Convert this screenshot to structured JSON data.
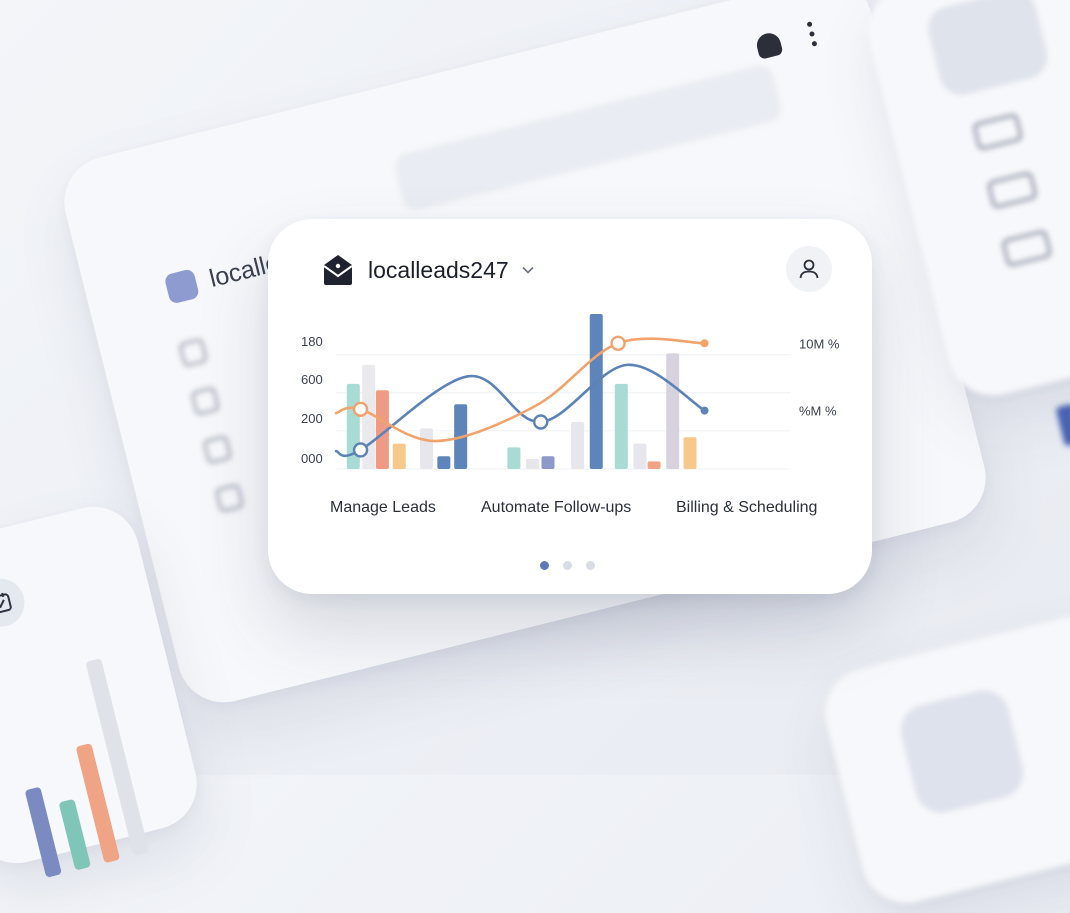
{
  "brand": {
    "name": "localleads247",
    "background_name": "localleads247"
  },
  "chart_data": {
    "type": "bar",
    "y_ticks": [
      "180",
      "600",
      "200",
      "000"
    ],
    "right_labels": [
      "10M %",
      "%M %"
    ],
    "categories": [
      "Manage Leads",
      "Automate Follow-ups",
      "Billing & Scheduling"
    ],
    "ylim": [
      0,
      1
    ],
    "bars": [
      {
        "x": 0.038,
        "value": 0.67,
        "color": "#a8dbd4"
      },
      {
        "x": 0.072,
        "value": 0.82,
        "color": "#e9e9ee"
      },
      {
        "x": 0.102,
        "value": 0.62,
        "color": "#ef9a84"
      },
      {
        "x": 0.139,
        "value": 0.2,
        "color": "#f7c88c"
      },
      {
        "x": 0.199,
        "value": 0.32,
        "color": "#e6e6ec"
      },
      {
        "x": 0.237,
        "value": 0.1,
        "color": "#5e85b9"
      },
      {
        "x": 0.274,
        "value": 0.51,
        "color": "#5e85b9"
      },
      {
        "x": 0.391,
        "value": 0.17,
        "color": "#a8dbd4"
      },
      {
        "x": 0.432,
        "value": 0.08,
        "color": "#e6e6ec"
      },
      {
        "x": 0.466,
        "value": 0.1,
        "color": "#8d98cb"
      },
      {
        "x": 0.531,
        "value": 0.37,
        "color": "#e6e6ec"
      },
      {
        "x": 0.572,
        "value": 1.22,
        "color": "#5e85b9"
      },
      {
        "x": 0.627,
        "value": 0.67,
        "color": "#a8dbd4"
      },
      {
        "x": 0.668,
        "value": 0.2,
        "color": "#e6e6ec"
      },
      {
        "x": 0.699,
        "value": 0.06,
        "color": "#f0a486"
      },
      {
        "x": 0.74,
        "value": 0.91,
        "color": "#d6d3de"
      },
      {
        "x": 0.778,
        "value": 0.25,
        "color": "#f7c88c"
      }
    ],
    "series": [
      {
        "color": "#5b83b7",
        "points": [
          [
            0.0,
            0.14
          ],
          [
            0.054,
            0.15
          ],
          [
            0.29,
            0.73
          ],
          [
            0.45,
            0.37
          ],
          [
            0.64,
            0.82
          ],
          [
            0.81,
            0.46
          ]
        ]
      },
      {
        "color": "#f2a36c",
        "points": [
          [
            0.0,
            0.44
          ],
          [
            0.054,
            0.47
          ],
          [
            0.22,
            0.22
          ],
          [
            0.44,
            0.5
          ],
          [
            0.62,
            0.99
          ],
          [
            0.81,
            0.99
          ]
        ]
      }
    ],
    "markers": [
      {
        "series": 0,
        "point": 1
      },
      {
        "series": 0,
        "point": 3
      },
      {
        "series": 0,
        "point": 5,
        "style": "dot"
      },
      {
        "series": 1,
        "point": 1
      },
      {
        "series": 1,
        "point": 4
      },
      {
        "series": 1,
        "point": 5,
        "style": "dot"
      }
    ]
  },
  "pager": {
    "count": 3,
    "active": 0
  },
  "colors": {
    "accent": "#5e79b8",
    "card": "#ffffff",
    "background": "#eef0f5"
  }
}
